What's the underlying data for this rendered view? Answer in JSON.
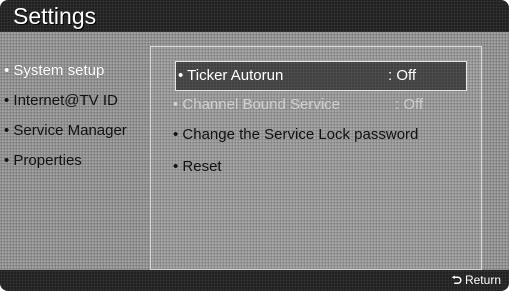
{
  "header": {
    "title": "Settings"
  },
  "sidebar": {
    "items": [
      {
        "label": "• System setup",
        "active": true
      },
      {
        "label": "• Internet@TV ID",
        "active": false
      },
      {
        "label": "• Service Manager",
        "active": false
      },
      {
        "label": "• Properties",
        "active": false
      }
    ]
  },
  "main": {
    "options": [
      {
        "label": "• Ticker Autorun",
        "value": ": Off",
        "state": "selected"
      },
      {
        "label": "• Channel Bound Service",
        "value": ": Off",
        "state": "disabled"
      },
      {
        "label": "• Change the Service Lock password",
        "value": "",
        "state": "normal"
      },
      {
        "label": "• Reset",
        "value": "",
        "state": "normal"
      }
    ]
  },
  "footer": {
    "return_label": "Return",
    "return_icon": "return-arrow-icon"
  }
}
